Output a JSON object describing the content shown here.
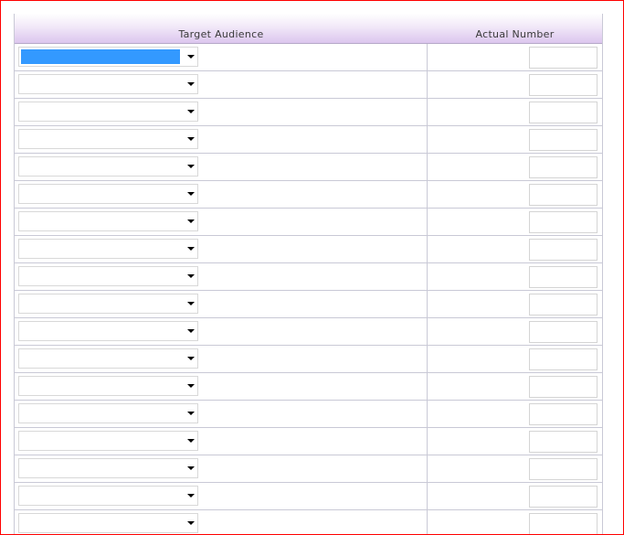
{
  "table": {
    "headers": {
      "target_audience": "Target Audience",
      "actual_number": "Actual Number"
    },
    "rows": [
      {
        "audience": "",
        "actual_number": ""
      },
      {
        "audience": "",
        "actual_number": ""
      },
      {
        "audience": "",
        "actual_number": ""
      },
      {
        "audience": "",
        "actual_number": ""
      },
      {
        "audience": "",
        "actual_number": ""
      },
      {
        "audience": "",
        "actual_number": ""
      },
      {
        "audience": "",
        "actual_number": ""
      },
      {
        "audience": "",
        "actual_number": ""
      },
      {
        "audience": "",
        "actual_number": ""
      },
      {
        "audience": "",
        "actual_number": ""
      },
      {
        "audience": "",
        "actual_number": ""
      },
      {
        "audience": "",
        "actual_number": ""
      },
      {
        "audience": "",
        "actual_number": ""
      },
      {
        "audience": "",
        "actual_number": ""
      },
      {
        "audience": "",
        "actual_number": ""
      },
      {
        "audience": "",
        "actual_number": ""
      },
      {
        "audience": "",
        "actual_number": ""
      },
      {
        "audience": "",
        "actual_number": ""
      }
    ],
    "focused_row": 0
  },
  "colors": {
    "frame_border": "#ff0000",
    "selection": "#3399ff",
    "header_gradient_end": "#dcc6ee",
    "grid_line": "#c9c9d6"
  },
  "icons": {
    "dropdown": "chevron-down-icon"
  }
}
